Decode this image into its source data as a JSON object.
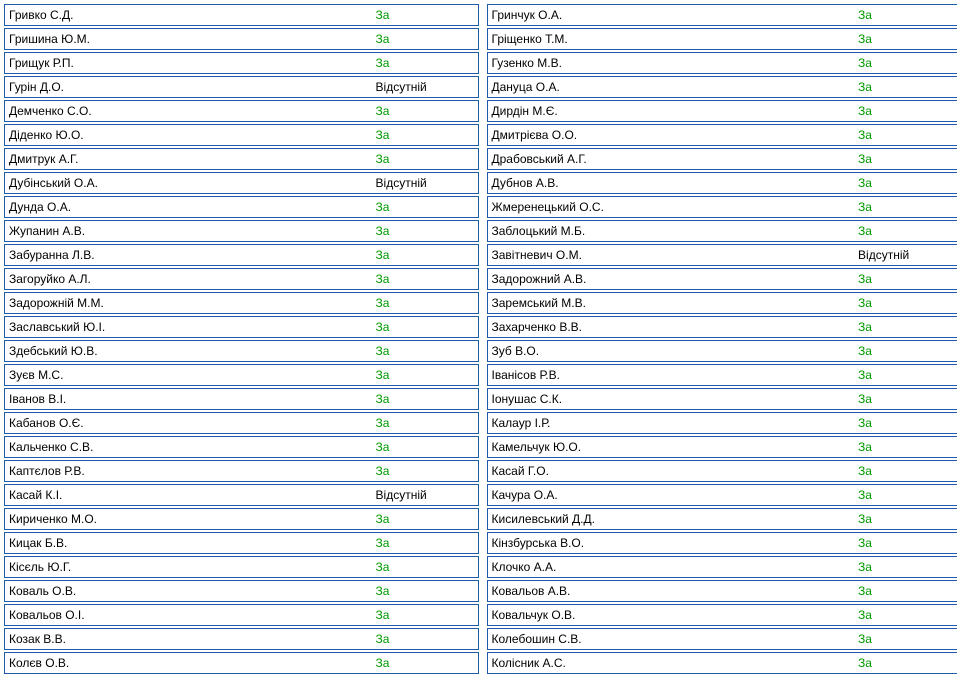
{
  "leftColumn": [
    {
      "name": "Гривко С.Д.",
      "vote": "За",
      "voteType": "za"
    },
    {
      "name": "Гришина Ю.М.",
      "vote": "За",
      "voteType": "za"
    },
    {
      "name": "Грищук Р.П.",
      "vote": "За",
      "voteType": "za"
    },
    {
      "name": "Гурін Д.О.",
      "vote": "Відсутній",
      "voteType": "absent"
    },
    {
      "name": "Демченко С.О.",
      "vote": "За",
      "voteType": "za"
    },
    {
      "name": "Діденко Ю.О.",
      "vote": "За",
      "voteType": "za"
    },
    {
      "name": "Дмитрук А.Г.",
      "vote": "За",
      "voteType": "za"
    },
    {
      "name": "Дубінський О.А.",
      "vote": "Відсутній",
      "voteType": "absent"
    },
    {
      "name": "Дунда О.А.",
      "vote": "За",
      "voteType": "za"
    },
    {
      "name": "Жупанин А.В.",
      "vote": "За",
      "voteType": "za"
    },
    {
      "name": "Забуранна Л.В.",
      "vote": "За",
      "voteType": "za"
    },
    {
      "name": "Загоруйко А.Л.",
      "vote": "За",
      "voteType": "za"
    },
    {
      "name": "Задорожній М.М.",
      "vote": "За",
      "voteType": "za"
    },
    {
      "name": "Заславський Ю.І.",
      "vote": "За",
      "voteType": "za"
    },
    {
      "name": "Здебський Ю.В.",
      "vote": "За",
      "voteType": "za"
    },
    {
      "name": "Зуєв М.С.",
      "vote": "За",
      "voteType": "za"
    },
    {
      "name": "Іванов В.І.",
      "vote": "За",
      "voteType": "za"
    },
    {
      "name": "Кабанов О.Є.",
      "vote": "За",
      "voteType": "za"
    },
    {
      "name": "Кальченко С.В.",
      "vote": "За",
      "voteType": "za"
    },
    {
      "name": "Каптєлов Р.В.",
      "vote": "За",
      "voteType": "za"
    },
    {
      "name": "Касай К.І.",
      "vote": "Відсутній",
      "voteType": "absent"
    },
    {
      "name": "Кириченко М.О.",
      "vote": "За",
      "voteType": "za"
    },
    {
      "name": "Кицак Б.В.",
      "vote": "За",
      "voteType": "za"
    },
    {
      "name": "Кісєль Ю.Г.",
      "vote": "За",
      "voteType": "za"
    },
    {
      "name": "Коваль О.В.",
      "vote": "За",
      "voteType": "za"
    },
    {
      "name": "Ковальов О.І.",
      "vote": "За",
      "voteType": "za"
    },
    {
      "name": "Козак В.В.",
      "vote": "За",
      "voteType": "za"
    },
    {
      "name": "Колєв О.В.",
      "vote": "За",
      "voteType": "za"
    }
  ],
  "rightColumn": [
    {
      "name": "Гринчук О.А.",
      "vote": "За",
      "voteType": "za"
    },
    {
      "name": "Гріщенко Т.М.",
      "vote": "За",
      "voteType": "za"
    },
    {
      "name": "Гузенко М.В.",
      "vote": "За",
      "voteType": "za"
    },
    {
      "name": "Дануца О.А.",
      "vote": "За",
      "voteType": "za"
    },
    {
      "name": "Дирдін М.Є.",
      "vote": "За",
      "voteType": "za"
    },
    {
      "name": "Дмитрієва О.О.",
      "vote": "За",
      "voteType": "za"
    },
    {
      "name": "Драбовський А.Г.",
      "vote": "За",
      "voteType": "za"
    },
    {
      "name": "Дубнов А.В.",
      "vote": "За",
      "voteType": "za"
    },
    {
      "name": "Жмеренецький О.С.",
      "vote": "За",
      "voteType": "za"
    },
    {
      "name": "Заблоцький М.Б.",
      "vote": "За",
      "voteType": "za"
    },
    {
      "name": "Завітневич О.М.",
      "vote": "Відсутній",
      "voteType": "absent"
    },
    {
      "name": "Задорожний А.В.",
      "vote": "За",
      "voteType": "za"
    },
    {
      "name": "Заремський М.В.",
      "vote": "За",
      "voteType": "za"
    },
    {
      "name": "Захарченко В.В.",
      "vote": "За",
      "voteType": "za"
    },
    {
      "name": "Зуб В.О.",
      "vote": "За",
      "voteType": "za"
    },
    {
      "name": "Іванісов Р.В.",
      "vote": "За",
      "voteType": "za"
    },
    {
      "name": "Іонушас С.К.",
      "vote": "За",
      "voteType": "za"
    },
    {
      "name": "Калаур І.Р.",
      "vote": "За",
      "voteType": "za"
    },
    {
      "name": "Камельчук Ю.О.",
      "vote": "За",
      "voteType": "za"
    },
    {
      "name": "Касай Г.О.",
      "vote": "За",
      "voteType": "za"
    },
    {
      "name": "Качура О.А.",
      "vote": "За",
      "voteType": "za"
    },
    {
      "name": "Кисилевський Д.Д.",
      "vote": "За",
      "voteType": "za"
    },
    {
      "name": "Кінзбурська В.О.",
      "vote": "За",
      "voteType": "za"
    },
    {
      "name": "Клочко А.А.",
      "vote": "За",
      "voteType": "za"
    },
    {
      "name": "Ковальов А.В.",
      "vote": "За",
      "voteType": "za"
    },
    {
      "name": "Ковальчук О.В.",
      "vote": "За",
      "voteType": "za"
    },
    {
      "name": "Колебошин С.В.",
      "vote": "За",
      "voteType": "za"
    },
    {
      "name": "Колісник А.С.",
      "vote": "За",
      "voteType": "za"
    }
  ]
}
